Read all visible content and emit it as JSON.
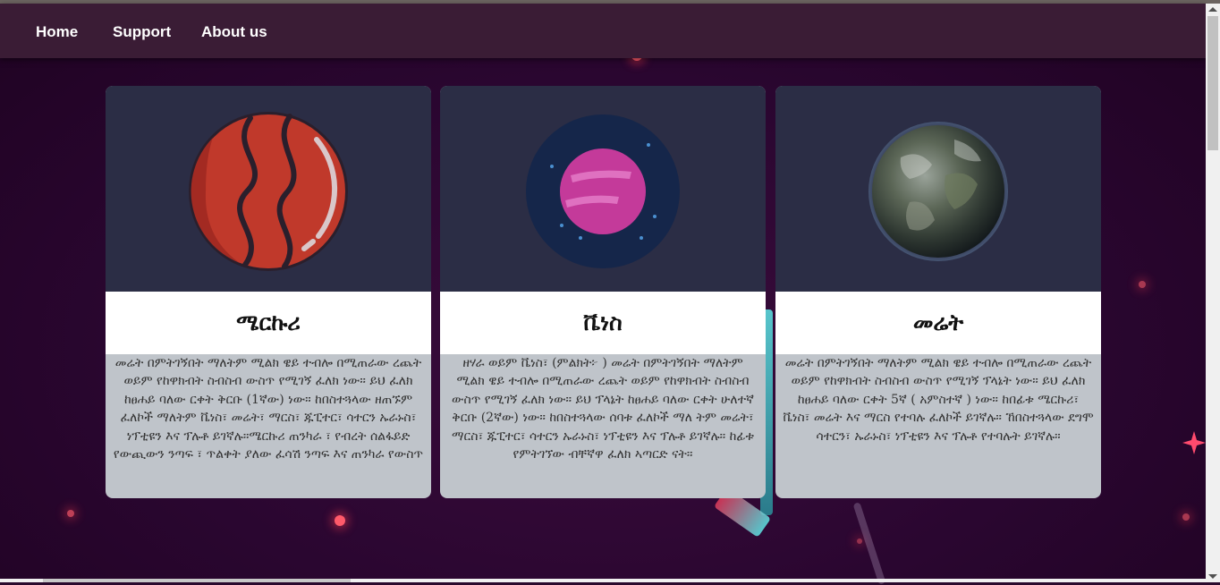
{
  "nav": {
    "items": [
      {
        "label": "Home"
      },
      {
        "label": "Support"
      },
      {
        "label": "About us"
      }
    ]
  },
  "cards": [
    {
      "title": "ሜርኩሪ",
      "image": "mercury-planet-illustration",
      "text": "መሬት በምትገኝበት ማለትም ሚልክ ዌይ ተብሎ በሚጠራው ረጨት ወይም የከዋክብት ስብስብ ውስጥ የሚገኝ ፈለክ ነው። ይህ ፈለክ ከፀሐይ ባለው ርቀት ቅርቡ (1ኛው) ነው። ከበስተጓላው ዘጠኙም ፈለኮች ማለትም ቬነስ፣ መሬት፣ ማርስ፣ ጁፒተር፣ ሳተርን ኡራኑስ፣ ነፕቲዩን እና ፕሉቶ ይገኛሉ።ሜርኩሪ ጠንካራ ፣ የብረት ሰልፋይድ የውጪውን ንጣፍ ፣ ጥልቀት ያለው ፈሳሽ ንጣፍ እና ጠንካራ የውስጥ"
    },
    {
      "title": "ቬነስ",
      "image": "venus-planet-illustration",
      "text": "ዘሃራ ወይም ቬነስ፣ (ምልክት፦ ) መሬት በምትገኝበት ማለትም ሚልክ ዌይ ተብሎ በሚጠራው ረጨት ወይም የከዋክብት ስብስብ ውስጥ የሚገኝ ፈለክ ነው። ይህ ፕላኔት ከፀሐይ ባለው ርቀት ሁለተኛ ቅርቡ (2ኛው) ነው። ከበስተጓላው ሰባቱ ፈለኮች ማለ ትም መሬት፣ ማርስ፣ ጁፒተር፣ ሳተርን ኡራኑስ፣ ነፕቲዩን እና ፕሉቶ ይገኛሉ። ከፊቱ የምትገኘው ብቸኛዋ ፈለክ ኣጣርድ ናት።"
    },
    {
      "title": "መሬት",
      "image": "earth-planet-photo",
      "text": "መሬት በምትገኝበት ማለትም ሚልክ ዌይ ተብሎ በሚጠራው ረጨት ወይም የከዋክብት ስብስብ ውስጥ የሚገኝ ፕላኔት ነው። ይህ ፈለክ ከፀሐይ ባለው ርቀት 5ኛ ( አምስተኛ ) ነው። ከበፊቱ ሜርኩሪ፣ ቬነስ፣ መሬት እና ማርስ የተባሉ ፈለኮች ይገኛሉ። ኸበስተጓላው ደግሞ ሳተርን፣ ኡራኑስ፣ ነፕቲዩን እና ፕሉቶ የተባሉት ይገኛሉ።"
    }
  ]
}
